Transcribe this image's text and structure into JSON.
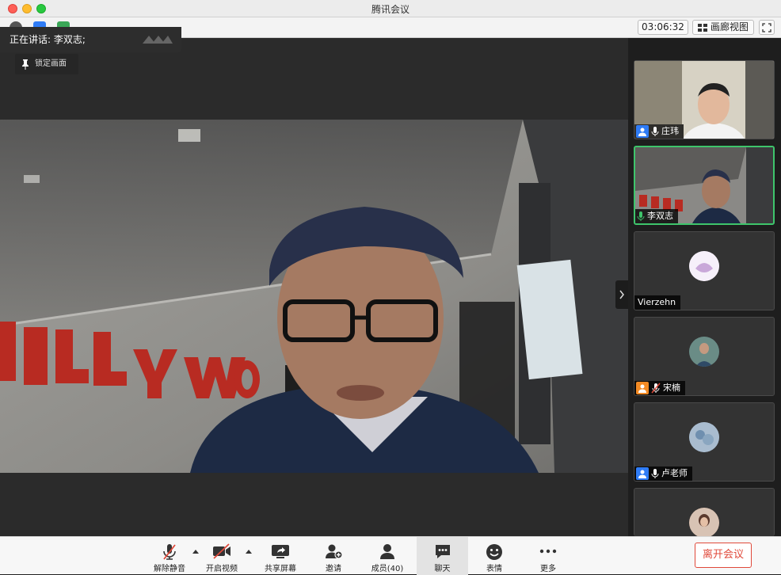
{
  "window": {
    "title": "腾讯会议"
  },
  "toolbar": {
    "timer": "03:06:32",
    "gallery_view_label": "画廊视图"
  },
  "speaking": {
    "text": "正在讲话: 李双志;"
  },
  "pin": {
    "label": "锁定画面"
  },
  "participants": [
    {
      "name": "庄玮",
      "badge": "blue",
      "mic": "on",
      "state": "video"
    },
    {
      "name": "李双志",
      "badge": "none",
      "mic": "on-green",
      "state": "video-active"
    },
    {
      "name": "Vierzehn",
      "badge": "none",
      "mic": "none",
      "state": "avatar"
    },
    {
      "name": "宋楠",
      "badge": "orange",
      "mic": "muted",
      "state": "avatar"
    },
    {
      "name": "卢老师",
      "badge": "blue",
      "mic": "on",
      "state": "avatar"
    },
    {
      "name": "",
      "badge": "none",
      "mic": "none",
      "state": "avatar-partial"
    }
  ],
  "controls": {
    "unmute": "解除静音",
    "start_video": "开启视频",
    "share_screen": "共享屏幕",
    "invite": "邀请",
    "members": "成员(40)",
    "chat": "聊天",
    "emoji": "表情",
    "more": "更多",
    "leave": "离开会议"
  },
  "colors": {
    "active_border": "#3ec56b",
    "leave_red": "#e0493a",
    "host_blue": "#2f7cf6",
    "cohost_orange": "#f28a24"
  }
}
